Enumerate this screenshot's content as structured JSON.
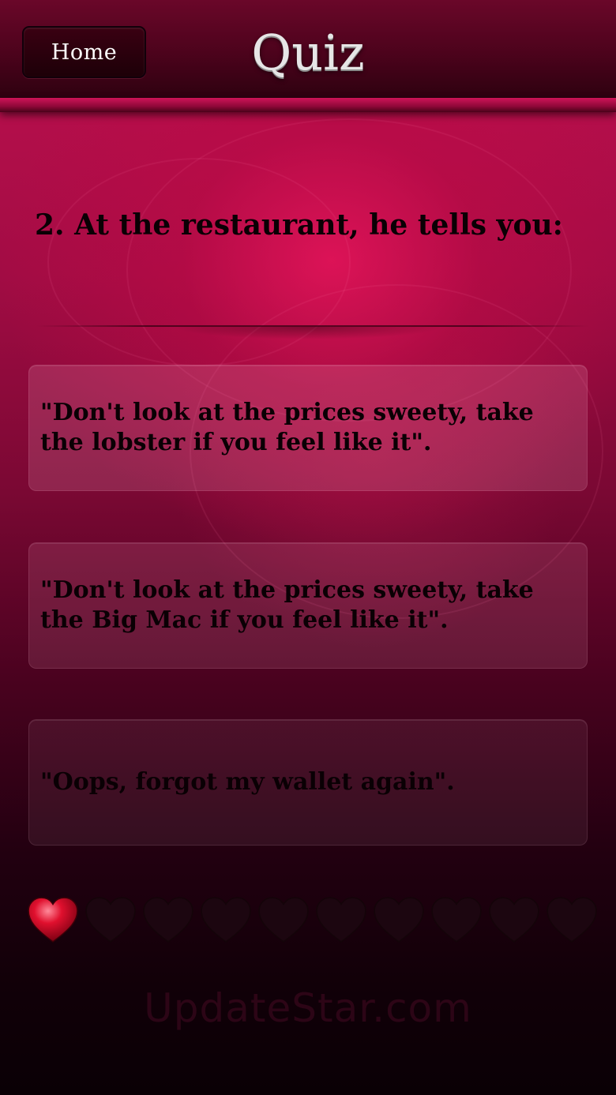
{
  "header": {
    "home_label": "Home",
    "title": "Quiz"
  },
  "question": {
    "text": "2. At the restaurant, he tells you:"
  },
  "answers": [
    {
      "text": "\"Don't look at the prices sweety, take the lobster if you feel like it\"."
    },
    {
      "text": "\"Don't look at the prices sweety, take the Big Mac if you feel like it\"."
    },
    {
      "text": "\"Oops, forgot my wallet again\"."
    }
  ],
  "progress": {
    "total": 10,
    "filled": 1,
    "filled_color": "#e0102e",
    "empty_color": "#1c0610",
    "icon": "heart-icon"
  },
  "watermark": {
    "text": "UpdateStar.com"
  },
  "colors": {
    "accent": "#c0104f",
    "header": "#4c031c",
    "text_dark": "#0a0004"
  }
}
